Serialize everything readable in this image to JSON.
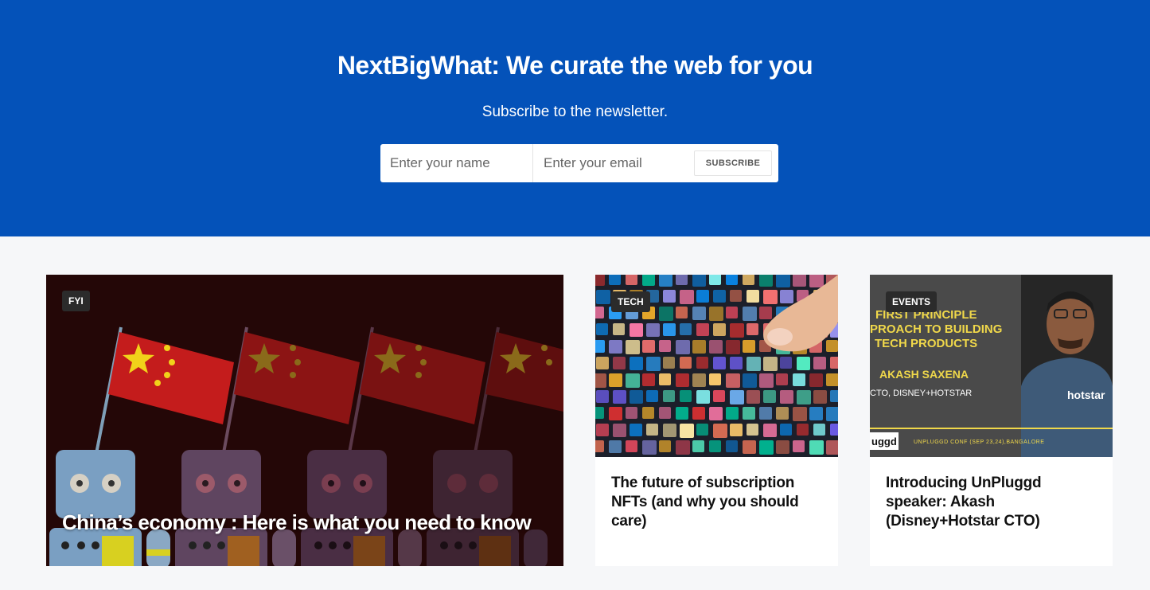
{
  "hero": {
    "title": "NextBigWhat: We curate the web for you",
    "subtitle": "Subscribe to the newsletter.",
    "name_placeholder": "Enter your name",
    "email_placeholder": "Enter your email",
    "subscribe_label": "SUBSCRIBE",
    "background_color": "#0452b9"
  },
  "articles": [
    {
      "category": "FYI",
      "title": "China’s economy : Here is what you need to know"
    },
    {
      "category": "TECH",
      "title": "The future of subscription NFTs (and why you should care)"
    },
    {
      "category": "EVENTS",
      "title": "Introducing UnPluggd speaker: Akash (Disney+Hotstar CTO)",
      "image_text": {
        "line1": "FIRST PRINCIPLE",
        "line2": "PROACH TO BUILDING",
        "line3": "TECH PRODUCTS",
        "speaker": "AKASH SAXENA",
        "role": "CTO, DISNEY+HOTSTAR",
        "shirt": "hotstar",
        "logo": "uggd",
        "conf": "UNPLUGGD CONF (SEP 23,24),BANGALORE"
      }
    }
  ]
}
